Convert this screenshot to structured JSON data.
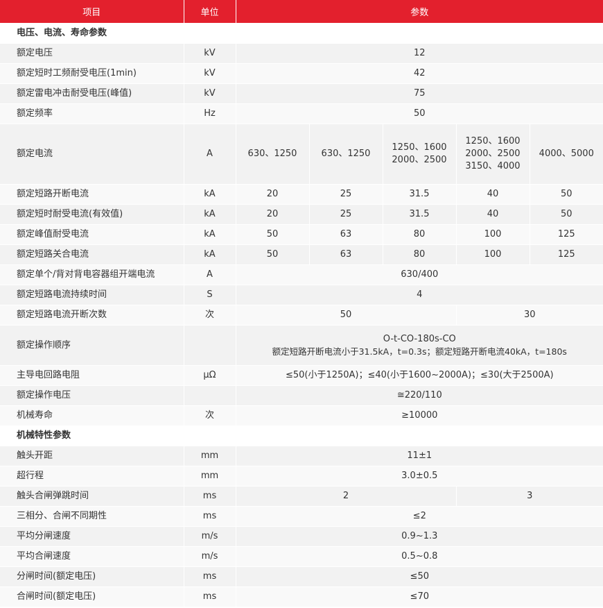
{
  "header": {
    "item": "项目",
    "unit": "单位",
    "params": "参数"
  },
  "sections": {
    "electrical": "电压、电流、寿命参数",
    "mechanical": "机械特性参数"
  },
  "rows": {
    "rated_voltage": {
      "item": "额定电压",
      "unit": "kV",
      "value": "12"
    },
    "power_freq": {
      "item": "额定短时工频耐受电压(1min)",
      "unit": "kV",
      "value": "42"
    },
    "lightning": {
      "item": "额定雷电冲击耐受电压(峰值)",
      "unit": "kV",
      "value": "75"
    },
    "frequency": {
      "item": "额定频率",
      "unit": "Hz",
      "value": "50"
    },
    "rated_current": {
      "item": "额定电流",
      "unit": "A",
      "v1": "630、1250",
      "v2": "630、1250",
      "v3a": "1250、1600",
      "v3b": "2000、2500",
      "v4a": "1250、1600",
      "v4b": "2000、2500",
      "v4c": "3150、4000",
      "v5": "4000、5000"
    },
    "breaking": {
      "item": "额定短路开断电流",
      "unit": "kA",
      "values": [
        "20",
        "25",
        "31.5",
        "40",
        "50"
      ]
    },
    "short_time": {
      "item": "额定短时耐受电流(有效值)",
      "unit": "kA",
      "values": [
        "20",
        "25",
        "31.5",
        "40",
        "50"
      ]
    },
    "peak": {
      "item": "额定峰值耐受电流",
      "unit": "kA",
      "values": [
        "50",
        "63",
        "80",
        "100",
        "125"
      ]
    },
    "making": {
      "item": "额定短路关合电流",
      "unit": "kA",
      "values": [
        "50",
        "63",
        "80",
        "100",
        "125"
      ]
    },
    "capacitor": {
      "item": "额定单个/背对背电容器组开端电流",
      "unit": "A",
      "value": "630/400"
    },
    "duration": {
      "item": "额定短路电流持续时间",
      "unit": "S",
      "value": "4"
    },
    "break_count": {
      "item": "额定短路电流开断次数",
      "unit": "次",
      "left": "50",
      "right": "30"
    },
    "op_sequence": {
      "item": "额定操作顺序",
      "unit": "",
      "line1": "O-t-CO-180s-CO",
      "line2": "额定短路开断电流小于31.5kA，t=0.3s；额定短路开断电流40kA，t=180s"
    },
    "resistance": {
      "item": "主导电回路电阻",
      "unit": "μΩ",
      "value": "≤50(小于1250A)；≤40(小于1600~2000A)；≤30(大于2500A)"
    },
    "op_voltage": {
      "item": "额定操作电压",
      "unit": "",
      "value": "≅220/110"
    },
    "mech_life": {
      "item": "机械寿命",
      "unit": "次",
      "value": "≥10000"
    },
    "contact_gap": {
      "item": "触头开距",
      "unit": "mm",
      "value": "11±1"
    },
    "overtravel": {
      "item": "超行程",
      "unit": "mm",
      "value": "3.0±0.5"
    },
    "bounce": {
      "item": "触头合闸弹跳时间",
      "unit": "ms",
      "left": "2",
      "right": "3"
    },
    "nonsync": {
      "item": "三相分、合闸不同期性",
      "unit": "ms",
      "value": "≤2"
    },
    "open_speed": {
      "item": "平均分闸速度",
      "unit": "m/s",
      "value": "0.9~1.3"
    },
    "close_speed": {
      "item": "平均合闸速度",
      "unit": "m/s",
      "value": "0.5~0.8"
    },
    "open_time": {
      "item": "分闸时间(额定电压)",
      "unit": "ms",
      "value": "≤50"
    },
    "close_time": {
      "item": "合闸时间(额定电压)",
      "unit": "ms",
      "value": "≤70"
    }
  },
  "colors": {
    "header_bg": "#e3202d",
    "row_odd": "#f2f2f2",
    "row_even": "#f9f9f9"
  }
}
